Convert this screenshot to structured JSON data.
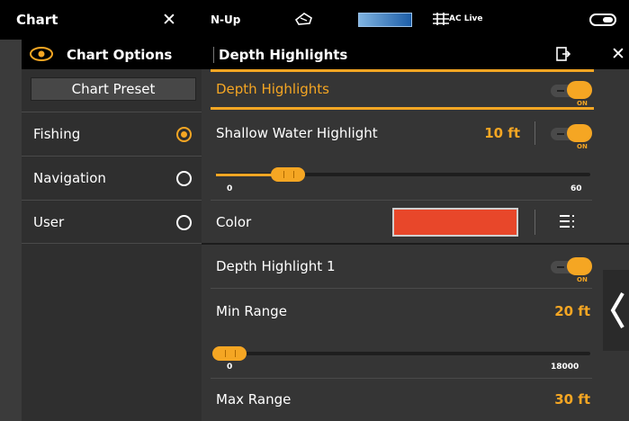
{
  "topbar": {
    "title": "Chart",
    "close_glyph": "✕",
    "orientation": "N-Up",
    "ac_label": "AC Live"
  },
  "left_panel": {
    "title": "Chart Options",
    "preset_label": "Chart Preset",
    "options": [
      {
        "label": "Fishing",
        "selected": true
      },
      {
        "label": "Navigation",
        "selected": false
      },
      {
        "label": "User",
        "selected": false
      }
    ]
  },
  "right_panel": {
    "title": "Depth Highlights",
    "rows": {
      "depth_highlights": {
        "label": "Depth Highlights",
        "toggle": "ON"
      },
      "shallow": {
        "label": "Shallow Water Highlight",
        "value": "10 ft",
        "toggle": "ON",
        "slider_min": "0",
        "slider_max": "60",
        "level": 10
      },
      "color": {
        "label": "Color",
        "swatch": "#e8472a"
      },
      "depth_highlight_1": {
        "label": "Depth Highlight 1",
        "toggle": "ON"
      },
      "min_range": {
        "label": "Min Range",
        "value": "20 ft",
        "slider_min": "0",
        "slider_max": "18000",
        "level": 20
      },
      "max_range": {
        "label": "Max Range",
        "value": "30 ft"
      }
    }
  },
  "colors": {
    "accent": "#f5a623",
    "panel": "#353535",
    "header": "#000000"
  }
}
